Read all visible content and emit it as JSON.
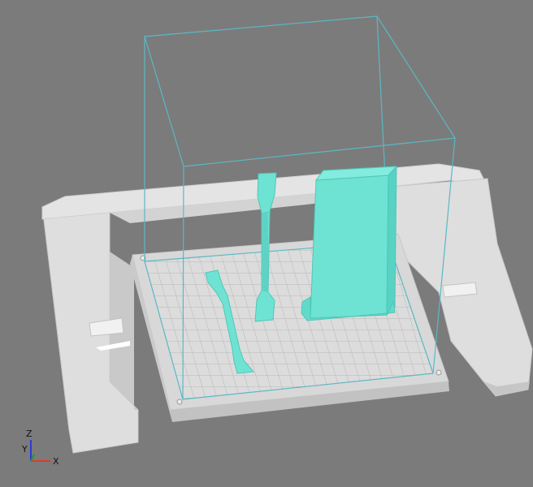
{
  "viewport": {
    "background": "#7a7a7a",
    "bed_frame_color": "#e6e6e6",
    "bed_color": "#d9d9d9",
    "grid_color": "#b8b8b8",
    "model_color": "#6fe3d3",
    "volume_outline_color": "#5bb8c4"
  },
  "models": [
    {
      "name": "tensile-specimen-flat",
      "shape": "dogbone"
    },
    {
      "name": "tensile-specimen-upright",
      "shape": "dogbone"
    },
    {
      "name": "rectangular-block",
      "shape": "box"
    }
  ],
  "axes_gizmo": {
    "z_label": "Z",
    "y_label": "Y",
    "x_label": "X",
    "x_color": "#e03a2a",
    "y_color": "#1a9b3a",
    "z_color": "#2d3ad6"
  }
}
